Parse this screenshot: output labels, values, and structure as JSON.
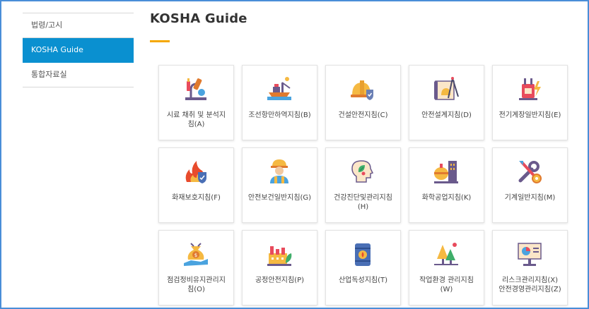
{
  "sidebar": {
    "items": [
      {
        "label": "법령/고시",
        "active": false
      },
      {
        "label": "KOSHA Guide",
        "active": true
      },
      {
        "label": "통합자료실",
        "active": false
      }
    ]
  },
  "page": {
    "title": "KOSHA Guide"
  },
  "guides": [
    {
      "label": "시료 채취 및 분석지\n침(A)",
      "icon": "microscope-icon"
    },
    {
      "label": "조선항만하역지침(B)",
      "icon": "ship-port-icon"
    },
    {
      "label": "건설안전지침(C)",
      "icon": "hardhat-shield-icon"
    },
    {
      "label": "안전설계지침(D)",
      "icon": "blueprint-compass-icon"
    },
    {
      "label": "전기계장일반지침(E)",
      "icon": "electric-plug-icon"
    },
    {
      "label": "화재보호지침(F)",
      "icon": "fire-shield-icon"
    },
    {
      "label": "안전보건일반지침(G)",
      "icon": "worker-icon"
    },
    {
      "label": "건강진단및관리지침\n(H)",
      "icon": "head-leaf-icon"
    },
    {
      "label": "화학공업지침(K)",
      "icon": "chemical-tank-icon"
    },
    {
      "label": "기계일반지침(M)",
      "icon": "wrench-gear-icon"
    },
    {
      "label": "점검정비유지관리지\n침(O)",
      "icon": "money-bag-hand-icon"
    },
    {
      "label": "공정안전지침(P)",
      "icon": "factory-icon"
    },
    {
      "label": "산업독성지침(T)",
      "icon": "toxic-barrel-icon"
    },
    {
      "label": "작업환경 관리지침\n(W)",
      "icon": "trees-icon"
    },
    {
      "label": "리스크관리지침(X)\n안전경영관리지침(Z)",
      "icon": "presentation-chart-icon"
    }
  ]
}
